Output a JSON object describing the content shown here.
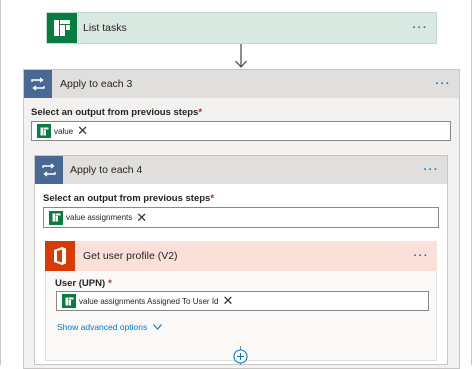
{
  "list_tasks": {
    "title": "List tasks",
    "icon": "planner-icon"
  },
  "apply_each_3": {
    "title": "Apply to each 3",
    "icon": "loop-icon",
    "field_label": "Select an output from previous steps",
    "required_mark": "*",
    "token": "value"
  },
  "apply_each_4": {
    "title": "Apply to each 4",
    "icon": "loop-icon",
    "field_label": "Select an output from previous steps",
    "required_mark": "*",
    "token": "value assignments"
  },
  "get_user_profile": {
    "title": "Get user profile (V2)",
    "icon": "office-icon",
    "field_label": "User (UPN)",
    "required_mark": "*",
    "token": "value assignments Assigned To User Id",
    "advanced_link": "Show advanced options"
  },
  "more_glyph": "···",
  "colors": {
    "planner": "#077d3f",
    "office": "#d83b01",
    "loop": "#486991",
    "link": "#0078d4",
    "list_tasks_bg": "#d9e8e1",
    "user_profile_bg": "#fbe0d9"
  }
}
